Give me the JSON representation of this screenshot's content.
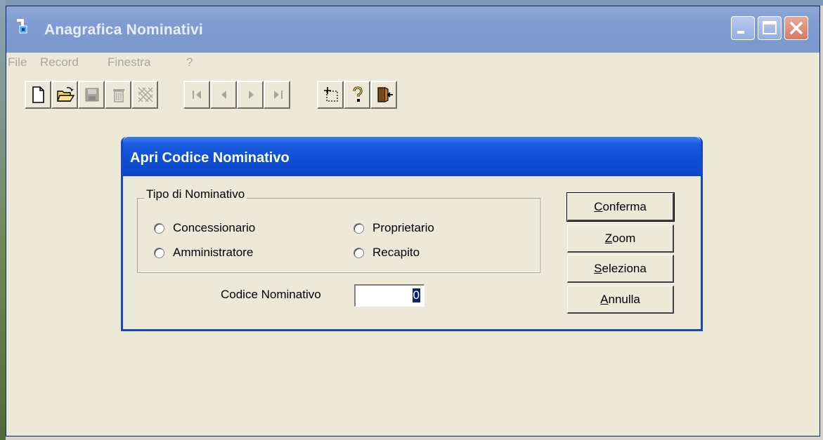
{
  "window": {
    "title": "Anagrafica Nominativi",
    "controls": [
      "minimize-icon",
      "maximize-icon",
      "close-icon"
    ]
  },
  "menu": {
    "items": [
      {
        "label": "File"
      },
      {
        "label": "Record"
      },
      {
        "label": "Finestra"
      },
      {
        "label": "?"
      }
    ]
  },
  "toolbar": {
    "buttons": [
      {
        "icon": "new-document-icon"
      },
      {
        "icon": "open-folder-icon"
      },
      {
        "icon": "save-icon"
      },
      {
        "icon": "delete-icon"
      },
      {
        "icon": "cancel-hatch-icon"
      },
      {
        "icon": "first-record-icon"
      },
      {
        "icon": "previous-record-icon"
      },
      {
        "icon": "next-record-icon"
      },
      {
        "icon": "last-record-icon"
      },
      {
        "icon": "zoom-select-icon"
      },
      {
        "icon": "help-icon"
      },
      {
        "icon": "exit-door-icon"
      }
    ]
  },
  "dialog": {
    "title": "Apri Codice Nominativo",
    "group_label": "Tipo di Nominativo",
    "options": [
      {
        "label": "Concessionario"
      },
      {
        "label": "Proprietario"
      },
      {
        "label": "Amministratore"
      },
      {
        "label": "Recapito"
      }
    ],
    "code_label": "Codice Nominativo",
    "code_value": "0",
    "buttons": {
      "confirm": {
        "accel": "C",
        "rest": "onferma"
      },
      "zoom": {
        "accel": "Z",
        "rest": "oom"
      },
      "select": {
        "accel": "S",
        "rest": "eleziona"
      },
      "cancel": {
        "accel": "A",
        "rest": "nnulla"
      }
    }
  },
  "colors": {
    "titlebar_inactive": "#7b97cc",
    "dialog_titlebar": "#0f4fd6",
    "face": "#ece9d8"
  }
}
